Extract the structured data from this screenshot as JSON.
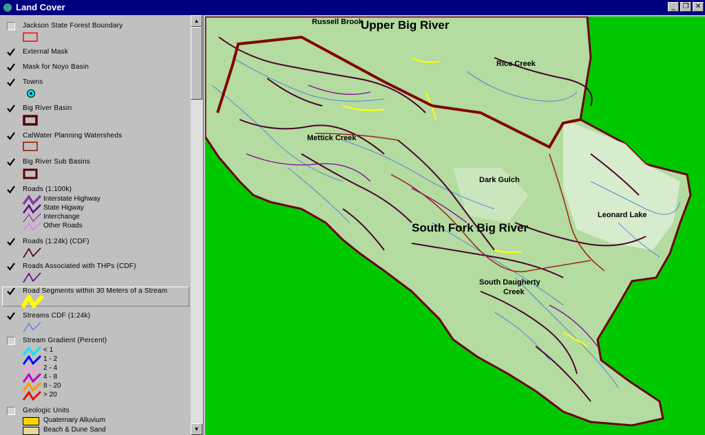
{
  "window": {
    "title": "Land Cover",
    "controls": [
      "_",
      "❐",
      "✕"
    ]
  },
  "legend": {
    "items": [
      {
        "label": "Jackson State Forest Boundary",
        "checked": false
      },
      {
        "label": "External Mask",
        "checked": true
      },
      {
        "label": "Mask for Noyo Basin",
        "checked": true
      },
      {
        "label": "Towns",
        "checked": true
      },
      {
        "label": "Big River Basin",
        "checked": true
      },
      {
        "label": "CalWater Planning Watersheds",
        "checked": true
      },
      {
        "label": "Big River Sub Basins",
        "checked": true
      },
      {
        "label": "Roads (1:100k)",
        "checked": true,
        "classes": [
          "Interstate Highway",
          "State Higway",
          "Interchange",
          "Other Roads"
        ]
      },
      {
        "label": "Roads (1:24k) (CDF)",
        "checked": true
      },
      {
        "label": "Roads Associated with THPs (CDF)",
        "checked": true
      },
      {
        "label": "Road Segments within 30 Meters of a Stream",
        "checked": true
      },
      {
        "label": "Streams CDF (1:24k)",
        "checked": true
      },
      {
        "label": "Stream Gradient (Percent)",
        "checked": false,
        "classes": [
          "< 1",
          "1 - 2",
          "2 - 4",
          "4 - 8",
          "8 - 20",
          "> 20"
        ]
      },
      {
        "label": "Geologic Units",
        "checked": false,
        "classes": [
          "Quaternary Alluvium",
          "Beach & Dune Sand"
        ]
      }
    ],
    "gradient_colors": [
      "#00e5ff",
      "#0000ff",
      "#ff9ee0",
      "#c000c0",
      "#ff9900",
      "#ff0000"
    ],
    "geology_colors": [
      "#ffd700",
      "#e8d8a0"
    ]
  },
  "map": {
    "labels": {
      "upper_big_river": "Upper Big River",
      "russell": "Russell Brook",
      "rice_creek": "Rice Creek",
      "mettick": "Mettick Creek",
      "dark_gulch": "Dark Gulch",
      "leonard": "Leonard Lake",
      "south_fork": "South Fork Big River",
      "daugherty_1": "South Daugherty",
      "daugherty_2": "Creek"
    }
  },
  "colors": {
    "mask": "#00c800",
    "terrain": "#b4dba0",
    "basin_boundary": "#800000",
    "roads": "#4b0030",
    "streams": "#3a6cf0",
    "stream_roads": "#ffff00"
  }
}
